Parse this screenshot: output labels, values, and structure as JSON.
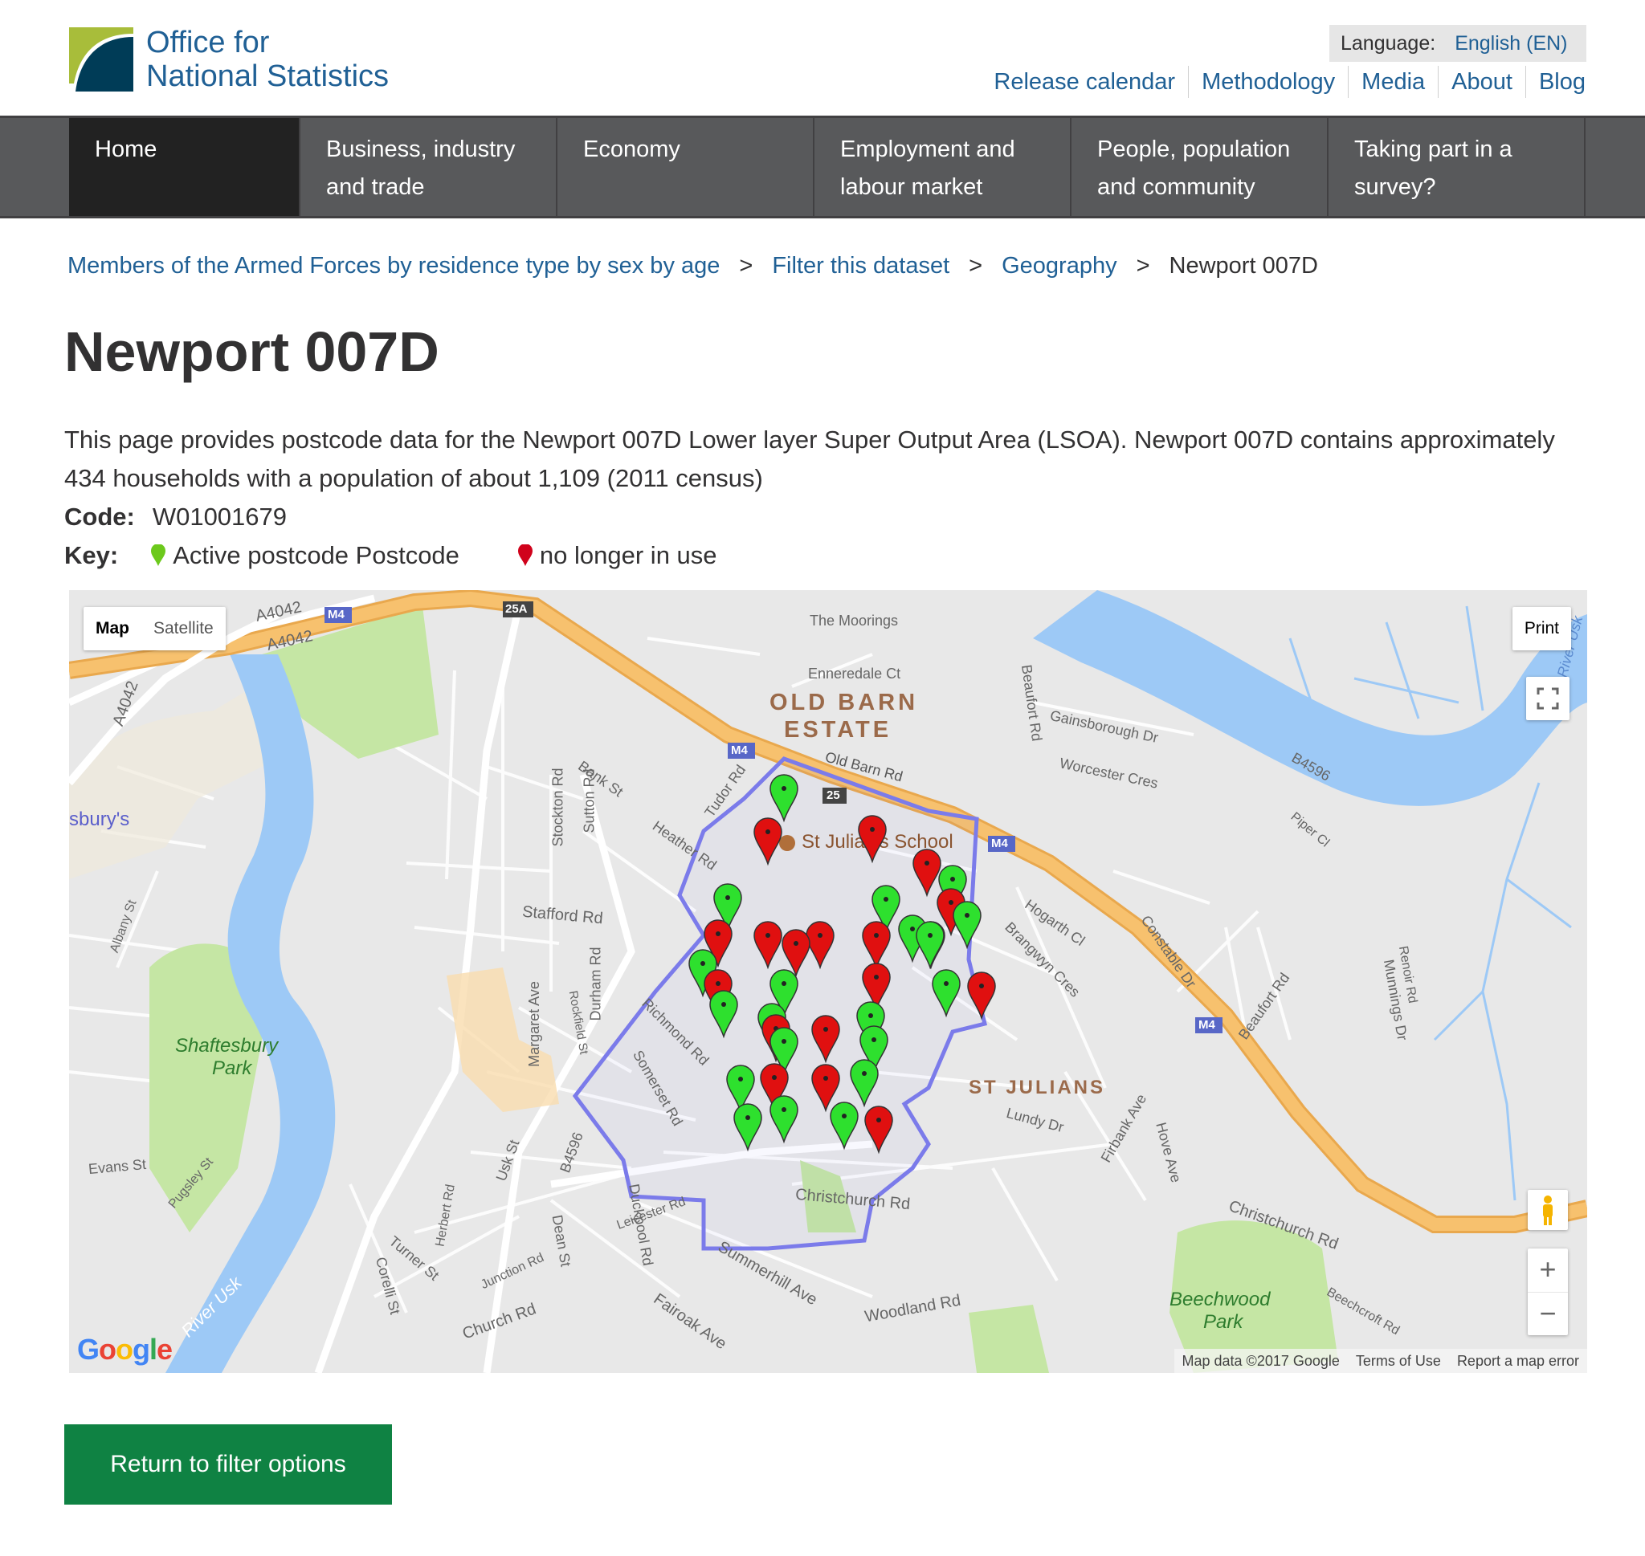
{
  "header": {
    "logo_line1": "Office for",
    "logo_line2": "National Statistics",
    "language_label": "Language:",
    "language_value": "English (EN)",
    "top_links": [
      "Release calendar",
      "Methodology",
      "Media",
      "About",
      "Blog"
    ]
  },
  "nav": {
    "items": [
      "Home",
      "Business, industry and trade",
      "Economy",
      "Employment and labour market",
      "People, population and community",
      "Taking part in a survey?"
    ],
    "active": "Home"
  },
  "breadcrumb": {
    "items": [
      "Members of the Armed Forces by residence type by sex by age",
      "Filter this dataset",
      "Geography"
    ],
    "separator": ">",
    "current": "Newport 007D"
  },
  "page": {
    "title": "Newport 007D",
    "intro": "This page provides postcode data for the Newport 007D Lower layer Super Output Area (LSOA). Newport 007D contains approximately 434 households with a population of about 1,109 (2011 census)",
    "code_label": "Code:",
    "code_value": "W01001679",
    "key_label": "Key:",
    "key_active": "Active postcode Postcode",
    "key_inactive": "no longer in use"
  },
  "map": {
    "type_map": "Map",
    "type_satellite": "Satellite",
    "selected_type": "Map",
    "print": "Print",
    "zoom_in": "+",
    "zoom_out": "−",
    "attribution": "Map data ©2017 Google",
    "terms": "Terms of Use",
    "report": "Report a map error",
    "logo": "Google",
    "labels": {
      "old_barn_1": "OLD BARN",
      "old_barn_2": "ESTATE",
      "st_julians": "ST JULIANS",
      "school": "St Julian's School",
      "shaftesbury_1": "Shaftesbury",
      "shaftesbury_2": "Park",
      "beechwood_1": "Beechwood",
      "beechwood_2": "Park",
      "sainsburys": "sbury's",
      "moorings": "The Moorings",
      "ennerdale": "Enneredale Ct",
      "old_barn_rd": "Old Barn Rd",
      "gainsborough": "Gainsborough Dr",
      "worcester": "Worcester Cres",
      "beaufort": "Beaufort Rd",
      "bank_st": "Bank St",
      "tudor_rd": "Tudor Rd",
      "heather_rd": "Heather Rd",
      "stockton": "Stockton Rd",
      "sutton": "Sutton Rd",
      "stafford": "Stafford Rd",
      "durham": "Durham Rd",
      "margaret": "Margaret Ave",
      "richmond": "Richmond Rd",
      "somerset": "Somerset Rd",
      "christchurch_rd": "Christchurch Rd",
      "christchurch_rd_e": "Christchurch Rd",
      "hogarth": "Hogarth Cl",
      "brangwyn": "Brangwyn Cres",
      "constable": "Constable Dr",
      "lundy": "Lundy Dr",
      "firbank": "Firbank Ave",
      "hove": "Hove Ave",
      "b4596": "B4596",
      "piper": "Piper Cl",
      "renoir": "Renoir Rd",
      "munnings": "Munnings Dr",
      "beaufort_rd2": "Beaufort Rd",
      "usk_st": "Usk St",
      "duckpool": "Duckpool Rd",
      "dean_st": "Dean St",
      "leicester": "Leicester Rd",
      "summerhill": "Summerhill Ave",
      "fairoak": "Fairoak Ave",
      "woodland": "Woodland Rd",
      "junction": "Junction Rd",
      "church_rd": "Church Rd",
      "turner": "Turner St",
      "herbert": "Herbert Rd",
      "corelli": "Corelli St",
      "evans": "Evans St",
      "pugsley": "Pugsley St",
      "albany": "Albany St",
      "river_usk": "River Usk",
      "river_usk_ne": "River Usk",
      "a4042_a": "A4042",
      "a4042_b": "A4042",
      "a4042_c": "A4042",
      "beechcroft": "Beechcroft Rd",
      "rockfield": "Rockfield St",
      "b4596_w": "B4596"
    },
    "shields": {
      "m4_1": "M4",
      "m4_2": "M4",
      "m4_3": "M4",
      "m4_4": "M4",
      "j25a": "25A",
      "j25": "25"
    },
    "colors": {
      "active_pin": "#2ee02e",
      "inactive_pin": "#e01010",
      "lsoa_boundary": "#7b7bea",
      "motorway": "#f7c16e",
      "water": "#9dc9f6",
      "park": "#c5e6a4"
    }
  },
  "actions": {
    "return_label": "Return to filter options"
  }
}
